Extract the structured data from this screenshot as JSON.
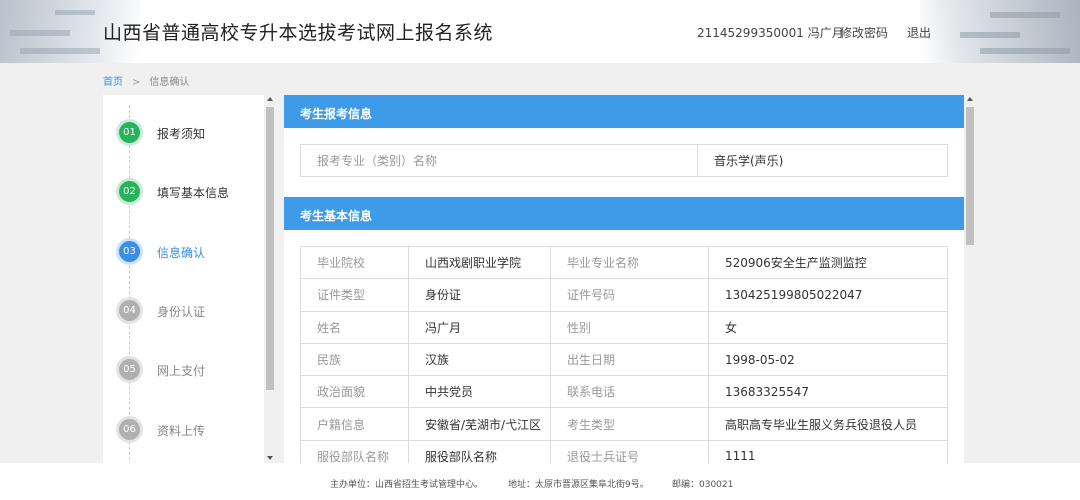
{
  "header": {
    "title": "山西省普通高校专升本选拔考试网上报名系统",
    "user_info": "21145299350001  冯广月",
    "change_password": "修改密码",
    "logout": "退出"
  },
  "breadcrumb": {
    "home": "首页",
    "separator": ">",
    "current": "信息确认"
  },
  "steps": [
    {
      "num": "01",
      "label": "报考须知",
      "state": "done"
    },
    {
      "num": "02",
      "label": "填写基本信息",
      "state": "done"
    },
    {
      "num": "03",
      "label": "信息确认",
      "state": "active"
    },
    {
      "num": "04",
      "label": "身份认证",
      "state": "todo"
    },
    {
      "num": "05",
      "label": "网上支付",
      "state": "todo"
    },
    {
      "num": "06",
      "label": "资料上传",
      "state": "todo"
    }
  ],
  "section1": {
    "title": "考生报考信息",
    "rows": [
      {
        "k": "报考专业（类别）名称",
        "v": "音乐学(声乐)"
      }
    ]
  },
  "section2": {
    "title": "考生基本信息",
    "rows": [
      [
        "毕业院校",
        "山西戏剧职业学院",
        "毕业专业名称",
        "520906安全生产监测监控"
      ],
      [
        "证件类型",
        "身份证",
        "证件号码",
        "130425199805022047"
      ],
      [
        "姓名",
        "冯广月",
        "性别",
        "女"
      ],
      [
        "民族",
        "汉族",
        "出生日期",
        "1998-05-02"
      ],
      [
        "政治面貌",
        "中共党员",
        "联系电话",
        "13683325547"
      ],
      [
        "户籍信息",
        "安徽省/芜湖市/弋江区",
        "考生类型",
        "高职高专毕业生服义务兵役退役人员"
      ],
      [
        "服役部队名称",
        "服役部队名称",
        "退役士兵证号",
        "1111"
      ]
    ]
  },
  "footer": {
    "organizer": "主办单位：山西省招生考试管理中心。",
    "address": "地址：太原市晋源区集阜北街9号。",
    "postcode": "邮编：030021"
  }
}
